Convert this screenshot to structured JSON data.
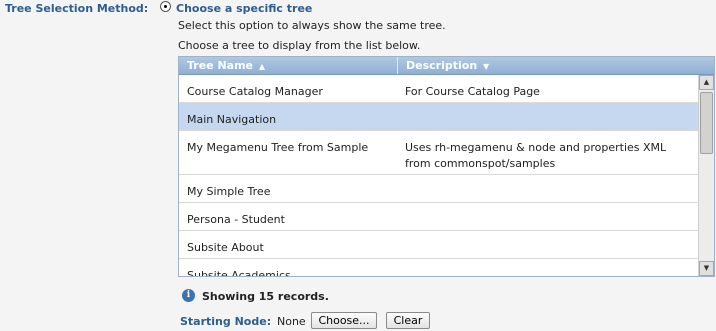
{
  "form": {
    "method_label": "Tree Selection Method:",
    "option_title": "Choose a specific tree",
    "option_desc": "Select this option to always show the same tree.",
    "list_prompt": "Choose a tree to display from the list below."
  },
  "grid": {
    "columns": [
      {
        "label": "Tree Name",
        "sort": "▲"
      },
      {
        "label": "Description",
        "sort": "▼"
      }
    ],
    "rows": [
      {
        "name": "Course Catalog Manager",
        "desc": "For Course Catalog Page",
        "selected": false
      },
      {
        "name": "Main Navigation",
        "desc": "",
        "selected": true
      },
      {
        "name": "My Megamenu Tree from Sample",
        "desc": "Uses rh-megamenu & node and properties XML from commonspot/samples",
        "selected": false
      },
      {
        "name": "My Simple Tree",
        "desc": "",
        "selected": false
      },
      {
        "name": "Persona - Student",
        "desc": "",
        "selected": false
      },
      {
        "name": "Subsite About",
        "desc": "",
        "selected": false
      },
      {
        "name": "Subsite Academics",
        "desc": "",
        "selected": false
      }
    ],
    "selected_color": "#c5d8ef",
    "header_color": "#8fb0d4"
  },
  "status": {
    "records_text": "Showing 15 records.",
    "info_icon": "info-icon"
  },
  "starting_node": {
    "label": "Starting Node:",
    "value": "None",
    "choose_label": "Choose...",
    "clear_label": "Clear"
  }
}
